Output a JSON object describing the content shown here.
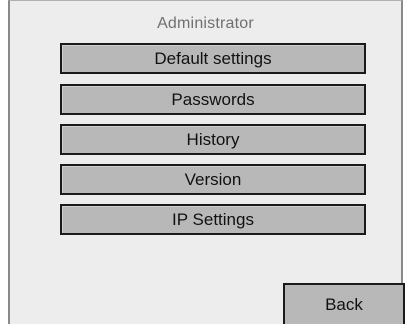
{
  "screen": {
    "title": "Administrator"
  },
  "menu": {
    "items": [
      {
        "label": "Default settings"
      },
      {
        "label": "Passwords"
      },
      {
        "label": "History"
      },
      {
        "label": "Version"
      },
      {
        "label": "IP Settings"
      }
    ]
  },
  "footer": {
    "back_label": "Back"
  }
}
